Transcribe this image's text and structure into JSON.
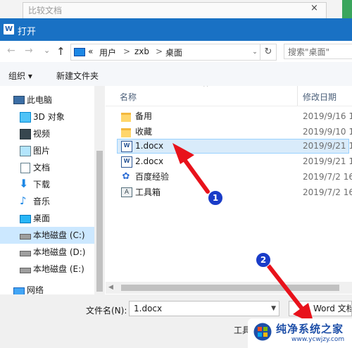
{
  "background_window": {
    "title": "比较文档",
    "close": "×"
  },
  "dialog": {
    "title": "打开",
    "app_icon": "W"
  },
  "address": {
    "back": "←",
    "forward": "→",
    "dropdown": "⌄",
    "up": "↑",
    "prefix": "«",
    "segments": [
      "用户",
      "zxb",
      "桌面"
    ],
    "separator": ">",
    "refresh": "↻",
    "search_placeholder": "搜索\"桌面\""
  },
  "toolbar": {
    "organize": "组织 ▾",
    "new_folder": "新建文件夹"
  },
  "nav": [
    {
      "label": "此电脑",
      "icon": "computer-icon"
    },
    {
      "label": "3D 对象",
      "icon": "cube-icon"
    },
    {
      "label": "视频",
      "icon": "video-icon"
    },
    {
      "label": "图片",
      "icon": "picture-icon"
    },
    {
      "label": "文档",
      "icon": "document-icon"
    },
    {
      "label": "下载",
      "icon": "download-icon"
    },
    {
      "label": "音乐",
      "icon": "music-icon"
    },
    {
      "label": "桌面",
      "icon": "desktop-icon"
    },
    {
      "label": "本地磁盘 (C:)",
      "icon": "drive-icon"
    },
    {
      "label": "本地磁盘 (D:)",
      "icon": "drive-icon"
    },
    {
      "label": "本地磁盘 (E:)",
      "icon": "drive-icon"
    },
    {
      "label": "网络",
      "icon": "network-icon"
    }
  ],
  "columns": {
    "name": "名称",
    "modified": "修改日期"
  },
  "files": [
    {
      "name": "备用",
      "date": "2019/9/16 1",
      "icon": "folder-icon"
    },
    {
      "name": "收藏",
      "date": "2019/9/10 1",
      "icon": "folder-icon"
    },
    {
      "name": "1.docx",
      "date": "2019/9/21 1",
      "icon": "word-doc-icon"
    },
    {
      "name": "2.docx",
      "date": "2019/9/21 1",
      "icon": "word-doc-icon"
    },
    {
      "name": "百度经验",
      "date": "2019/7/2 16",
      "icon": "baidu-paw-icon"
    },
    {
      "name": "工具箱",
      "date": "2019/7/2 16",
      "icon": "toolbox-icon"
    }
  ],
  "bottom": {
    "filename_label": "文件名(N):",
    "filename_value": "1.docx",
    "filetype": "Word 文档",
    "tools": "工具"
  },
  "annotations": {
    "badge1": "1",
    "badge2": "2"
  },
  "watermark": {
    "title": "纯净系统之家",
    "url": "www.ycwjzy.com"
  },
  "colors": {
    "accent": "#1971c4",
    "selection": "#cce8ff",
    "annotation_red": "#e8121b",
    "badge_blue": "#1a3cc8"
  }
}
